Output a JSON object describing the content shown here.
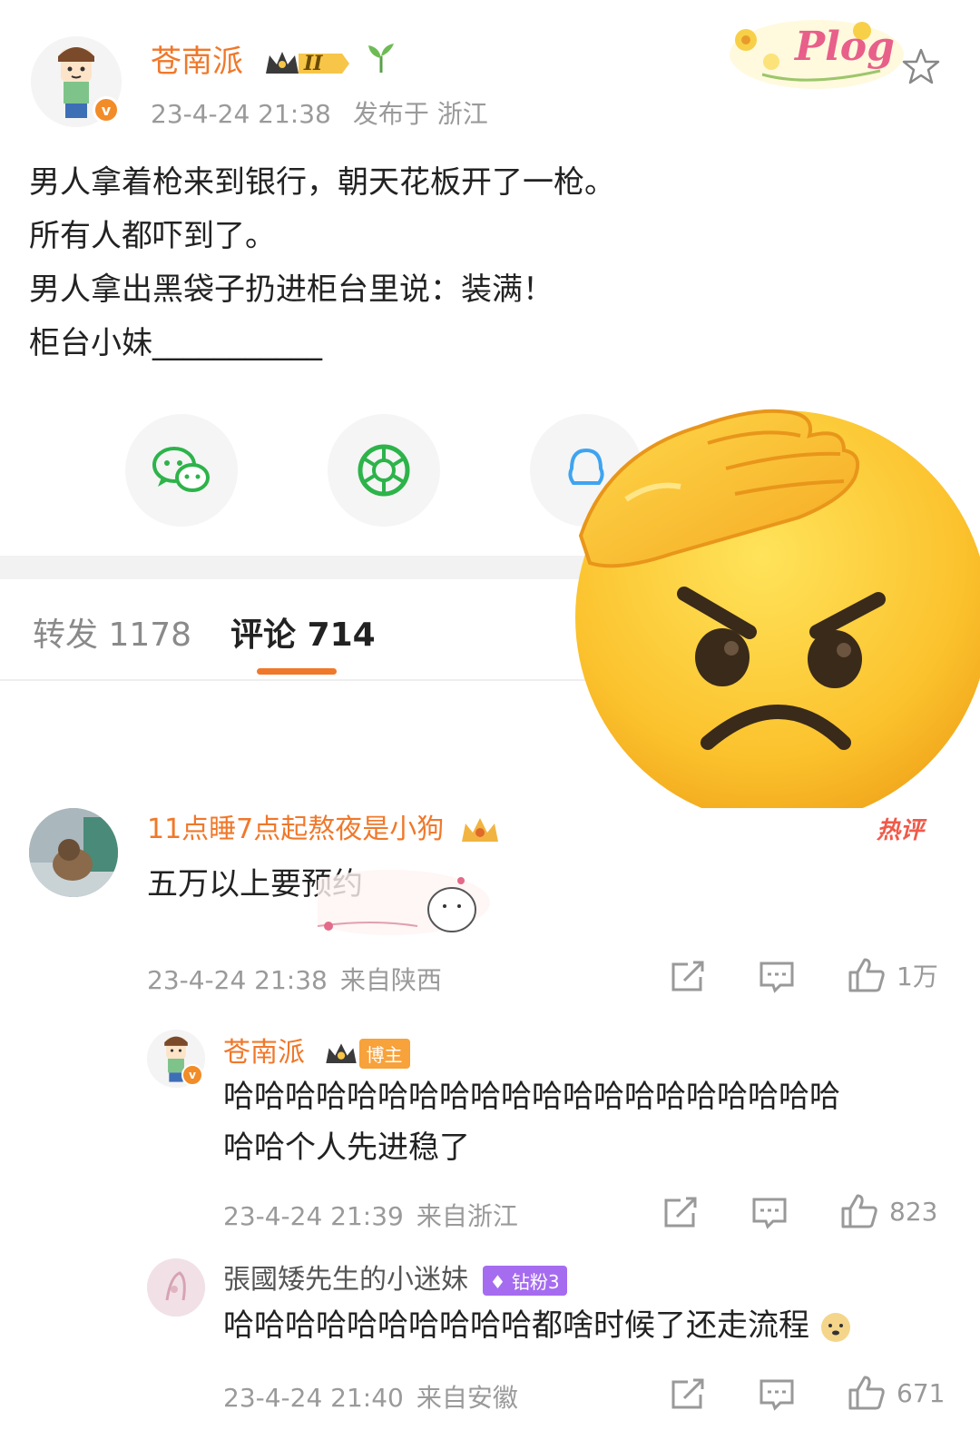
{
  "post": {
    "author": "苍南派",
    "level_badge": "II",
    "time": "23-4-24 21:38",
    "location": "发布于 浙江",
    "lines": [
      "男人拿着枪来到银行，朝天花板开了一枪。",
      "所有人都吓到了。",
      "男人拿出黑袋子扔进柜台里说：装满！",
      "柜台小妹___________"
    ],
    "sticker_text": "Plog"
  },
  "tabs": {
    "forward_label": "转发",
    "forward_count": "1178",
    "comment_label": "评论",
    "comment_count": "714"
  },
  "comments": [
    {
      "name": "11点睡7点起熬夜是小狗",
      "text": "五万以上要预约",
      "time": "23-4-24 21:38",
      "location": "来自陕西",
      "likes": "1万",
      "hot": "热评"
    },
    {
      "name": "苍南派",
      "badge": "博主",
      "lines": [
        "哈哈哈哈哈哈哈哈哈哈哈哈哈哈哈哈哈哈哈哈",
        "哈哈个人先进稳了"
      ],
      "time": "23-4-24 21:39",
      "location": "来自浙江",
      "likes": "823"
    },
    {
      "name": "張國矮先生的小迷妹",
      "badge": "钻粉3",
      "text": "哈哈哈哈哈哈哈哈哈哈都啥时候了还走流程",
      "time": "23-4-24 21:40",
      "location": "来自安徽",
      "likes": "671"
    }
  ],
  "colors": {
    "accent": "#f0782a",
    "wechat_green": "#2db34a",
    "emoji_yellow": "#fbc02d"
  },
  "icons": [
    "wechat-icon",
    "moments-icon",
    "qq-icon",
    "share-icon",
    "comment-icon",
    "like-icon",
    "star-icon",
    "salute-angry-emoji"
  ]
}
